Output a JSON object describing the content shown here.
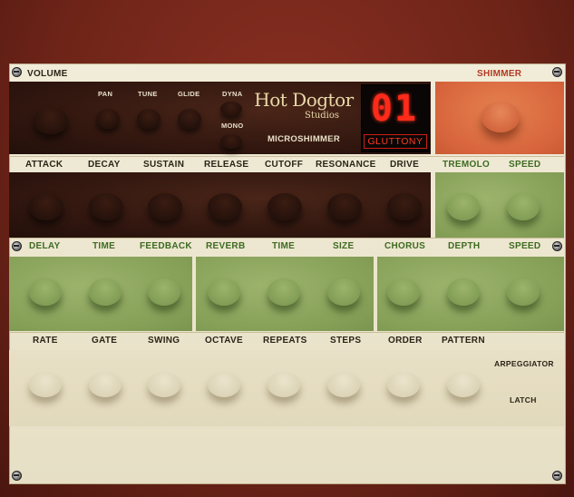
{
  "header": {
    "volume_label": "VOLUME",
    "shimmer_label": "SHIMMER"
  },
  "top_section": {
    "small_labels": [
      "PAN",
      "TUNE",
      "GLIDE",
      "DYNA"
    ],
    "mono_label": "MONO",
    "logo_main": "Hot Dogtor",
    "logo_sub": "Studios",
    "product_name": "MICROSHIMMER",
    "preset_number": "01",
    "preset_name": "GLUTTONY"
  },
  "row1_labels": [
    "ATTACK",
    "DECAY",
    "SUSTAIN",
    "RELEASE",
    "CUTOFF",
    "RESONANCE",
    "DRIVE",
    "TREMOLO",
    "SPEED"
  ],
  "row2_labels": [
    "DELAY",
    "TIME",
    "FEEDBACK",
    "REVERB",
    "TIME",
    "SIZE",
    "CHORUS",
    "DEPTH",
    "SPEED"
  ],
  "row3_labels": [
    "RATE",
    "GATE",
    "SWING",
    "OCTAVE",
    "REPEATS",
    "STEPS",
    "ORDER",
    "PATTERN"
  ],
  "arp": {
    "arpeggiator_label": "ARPEGGIATOR",
    "latch_label": "LATCH"
  },
  "colors": {
    "background": "#6e2418",
    "panel": "#ebe4cc",
    "dark_section": "#2e150e",
    "green_section": "#86a058",
    "orange_section": "#d8653d",
    "led": "#ff2a1a",
    "green_text": "#3e6b22",
    "red_text": "#b23a22"
  }
}
